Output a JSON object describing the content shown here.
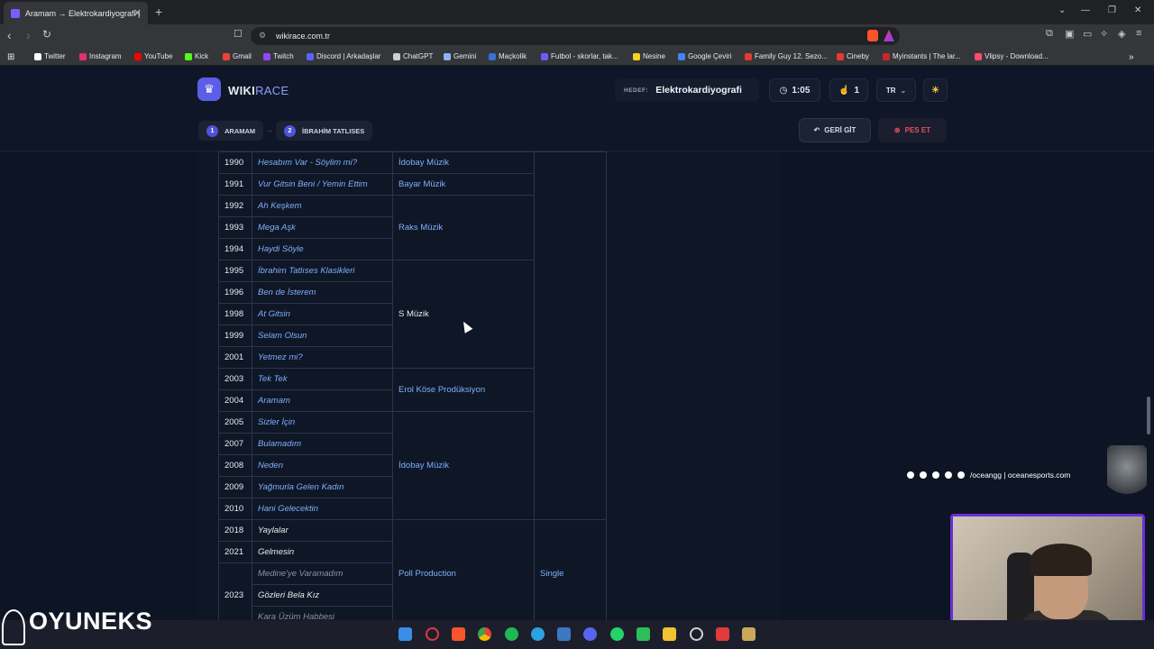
{
  "browser": {
    "tab_title": "Aramam → Elektrokardiyografi |",
    "url": "wikirace.com.tr",
    "bookmarks": [
      {
        "label": "Twitter",
        "color": "#ffffff"
      },
      {
        "label": "Instagram",
        "color": "#e1306c"
      },
      {
        "label": "YouTube",
        "color": "#ff0000"
      },
      {
        "label": "Kick",
        "color": "#53fc18"
      },
      {
        "label": "Gmail",
        "color": "#ea4335"
      },
      {
        "label": "Twitch",
        "color": "#9146ff"
      },
      {
        "label": "Discord | Arkadaşlar",
        "color": "#5865f2"
      },
      {
        "label": "ChatGPT",
        "color": "#cfcfcf"
      },
      {
        "label": "Gemini",
        "color": "#8ab4f8"
      },
      {
        "label": "Maçkolik",
        "color": "#3b6fd1"
      },
      {
        "label": "Futbol - skorlar, tak...",
        "color": "#6a5cff"
      },
      {
        "label": "Nesine",
        "color": "#f7d21b"
      },
      {
        "label": "Google Çeviri",
        "color": "#4285f4"
      },
      {
        "label": "Family Guy 12. Sezo...",
        "color": "#e53935"
      },
      {
        "label": "Cineby",
        "color": "#e53935"
      },
      {
        "label": "Myinstants | The lar...",
        "color": "#c62828"
      },
      {
        "label": "Vlipsy - Download...",
        "color": "#ff4d6d"
      }
    ]
  },
  "header": {
    "logo_text_a": "WIKI",
    "logo_text_b": "RACE",
    "target_label": "HEDEF:",
    "target_value": "Elektrokardiyografi",
    "timer": "1:05",
    "clicks": "1",
    "lang": "TR",
    "crumbs": [
      {
        "num": "1",
        "label": "ARAMAM"
      },
      {
        "num": "2",
        "label": "İBRAHİM TATLISES"
      }
    ],
    "back_label": "GERİ GİT",
    "giveup_label": "PES ET"
  },
  "table": {
    "labels": {
      "idobay1": "İdobay Müzik",
      "bayar": "Bayar Müzik",
      "raks": "Raks Müzik",
      "s": "S Müzik",
      "erol": "Erol Köse Prodüksiyon",
      "idobay2": "İdobay Müzik",
      "poll": "Poll Production",
      "single": "Single"
    },
    "rows": [
      {
        "year": "1990",
        "title": "Hesabım Var - Söylim mi?"
      },
      {
        "year": "1991",
        "title": "Vur Gitsin Beni / Yemin Ettim"
      },
      {
        "year": "1992",
        "title": "Ah Keşkem"
      },
      {
        "year": "1993",
        "title": "Mega Aşk"
      },
      {
        "year": "1994",
        "title": "Haydi Söyle"
      },
      {
        "year": "1995",
        "title": "İbrahim Tatlıses Klasikleri"
      },
      {
        "year": "1996",
        "title": "Ben de İsterem"
      },
      {
        "year": "1998",
        "title": "At Gitsin"
      },
      {
        "year": "1999",
        "title": "Selam Olsun"
      },
      {
        "year": "2001",
        "title": "Yetmez mi?"
      },
      {
        "year": "2003",
        "title": "Tek Tek"
      },
      {
        "year": "2004",
        "title": "Aramam"
      },
      {
        "year": "2005",
        "title": "Sizler İçin"
      },
      {
        "year": "2007",
        "title": "Bulamadım"
      },
      {
        "year": "2008",
        "title": "Neden"
      },
      {
        "year": "2009",
        "title": "Yağmurla Gelen Kadın"
      },
      {
        "year": "2010",
        "title": "Hani Gelecektin"
      },
      {
        "year": "2018",
        "title": "Yaylalar"
      },
      {
        "year": "2021",
        "title": "Gelmesin"
      },
      {
        "year": "",
        "title": "Medine'ye Varamadım"
      },
      {
        "year": "2023",
        "title": "Gözleri Bela Kız"
      },
      {
        "year": "",
        "title": "Kara Üzüm Habbesi"
      }
    ]
  },
  "overlay": {
    "social_text": "/oceangg | oceanesports.com",
    "brand": "OYUNEKS"
  }
}
